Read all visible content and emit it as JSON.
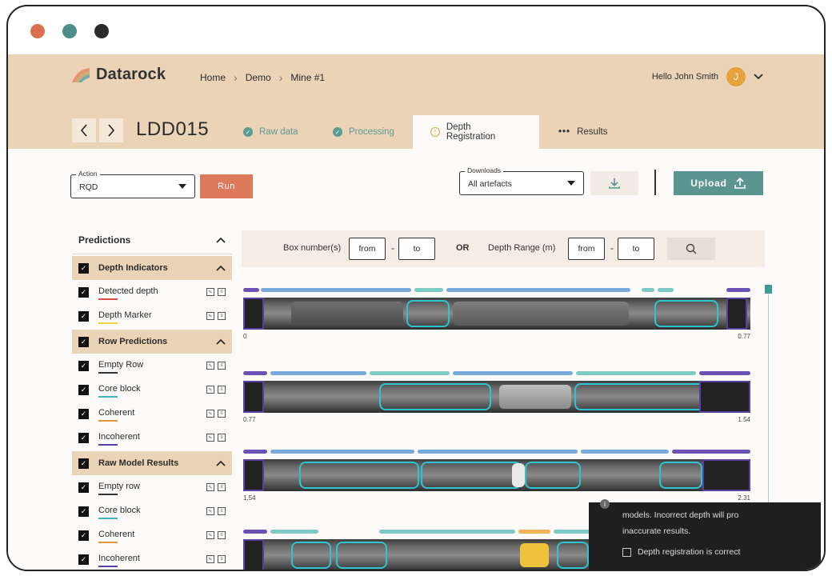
{
  "window": {
    "dot_colors": [
      "#d9704f",
      "#4d8e8a",
      "#2b2b2b"
    ]
  },
  "header": {
    "logo_text": "Datarock",
    "breadcrumb": [
      "Home",
      "Demo",
      "Mine #1"
    ],
    "greeting": "Hello John Smith",
    "avatar_initial": "J"
  },
  "hole": {
    "title": "LDD015"
  },
  "tabs": [
    {
      "label": "Raw data",
      "status": "done"
    },
    {
      "label": "Processing",
      "status": "done"
    },
    {
      "label": "Depth Registration",
      "status": "warning",
      "active": true
    },
    {
      "label": "Results",
      "status": "more"
    }
  ],
  "action": {
    "label": "Action",
    "value": "RQD",
    "run_label": "Run"
  },
  "downloads": {
    "label": "Downloads",
    "value": "All artefacts"
  },
  "upload": {
    "label": "Upload"
  },
  "predictions": {
    "title": "Predictions",
    "groups": [
      {
        "label": "Depth Indicators",
        "items": [
          {
            "label": "Detected depth",
            "color": "#e04a4a"
          },
          {
            "label": "Depth Marker",
            "color": "#e8d13a"
          }
        ]
      },
      {
        "label": "Row Predictions",
        "items": [
          {
            "label": "Empty Row",
            "color": "#333333"
          },
          {
            "label": "Core block",
            "color": "#3ab3c4"
          },
          {
            "label": "Coherent",
            "color": "#e8953a"
          },
          {
            "label": "Incoherent",
            "color": "#5a3fa0"
          }
        ]
      },
      {
        "label": "Raw Model Results",
        "items": [
          {
            "label": "Empty row",
            "color": "#333333"
          },
          {
            "label": "Core block",
            "color": "#3ab3c4"
          },
          {
            "label": "Coherent",
            "color": "#e8953a"
          },
          {
            "label": "Incoherent",
            "color": "#5a3fa0"
          }
        ]
      }
    ]
  },
  "filter": {
    "box_label": "Box number(s)",
    "from": "from",
    "to": "to",
    "or": "OR",
    "depth_label": "Depth Range (m)",
    "dash": "-"
  },
  "strips": [
    {
      "start": "0",
      "end": "0.77"
    },
    {
      "start": "0.77",
      "end": "1.54"
    },
    {
      "start": "1.54",
      "end": "2.31"
    },
    {
      "start": "",
      "end": ""
    }
  ],
  "toast": {
    "line1": "models. Incorrect depth will pro",
    "line2": "inaccurate results.",
    "checkbox": "Depth registration is correct"
  },
  "colors": {
    "accent": "#5b9490",
    "run": "#dd7a5c",
    "header_bg": "#ead3b6",
    "track_blue": "#79a9dd",
    "track_teal": "#7ccac3",
    "track_purple": "#6a51b4",
    "track_orange": "#f0b35a"
  },
  "icons": [
    "chevron-left-icon",
    "chevron-right-icon",
    "check-icon",
    "warning-icon",
    "more-icon",
    "download-icon",
    "upload-icon",
    "search-icon",
    "chevron-up-icon",
    "chevron-down-icon"
  ]
}
